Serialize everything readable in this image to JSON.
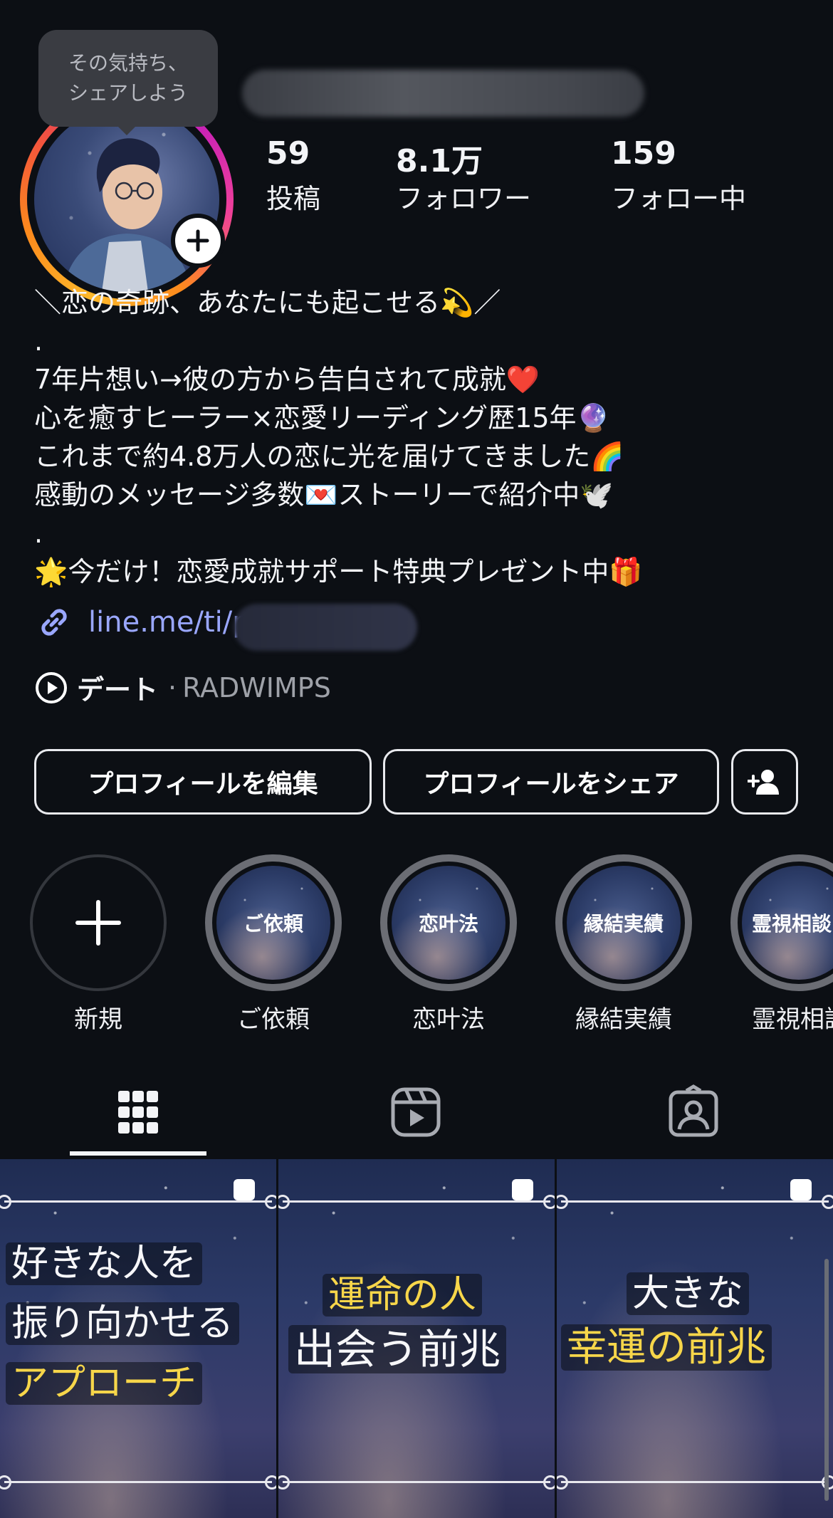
{
  "profile": {
    "tooltip_line1": "その気持ち、",
    "tooltip_line2": "シェアしよう",
    "stats": [
      {
        "value": "59",
        "label": "投稿"
      },
      {
        "value": "8.1万",
        "label": "フォロワー"
      },
      {
        "value": "159",
        "label": "フォロー中"
      }
    ],
    "bio": "＼恋の奇跡、あなたにも起こせる💫／\n.\n7年片想い→彼の方から告白されて成就❤️\n心を癒すヒーラー×恋愛リーディング歴15年🔮\nこれまで約4.8万人の恋に光を届けてきました🌈\n感動のメッセージ多数💌ストーリーで紹介中🕊️\n.\n🌟今だけ！恋愛成就サポート特典プレゼント中🎁",
    "link_text": "line.me/ti/p",
    "music_title": "デート",
    "music_separator": "·",
    "music_artist": "RADWIMPS"
  },
  "buttons": {
    "edit_label": "プロフィールを編集",
    "share_label": "プロフィールをシェア"
  },
  "highlights": [
    {
      "label": "新規",
      "cover_text": ""
    },
    {
      "label": "ご依頼",
      "cover_text": "ご依頼"
    },
    {
      "label": "恋叶法",
      "cover_text": "恋叶法"
    },
    {
      "label": "縁結実績",
      "cover_text": "縁結実績"
    },
    {
      "label": "霊視相談",
      "cover_text": "霊視相談"
    }
  ],
  "tabs": [
    {
      "icon": "grid-icon",
      "active": true
    },
    {
      "icon": "reels-icon",
      "active": false
    },
    {
      "icon": "tagged-icon",
      "active": false
    }
  ],
  "posts": [
    {
      "lines": [
        "好きな人を",
        "振り向かせる",
        "アプローチ"
      ]
    },
    {
      "lines": [
        "運命の人",
        "出会う前兆"
      ]
    },
    {
      "lines": [
        "大きな",
        "幸運の前兆"
      ]
    }
  ],
  "colors": {
    "background": "#0c0f14",
    "link": "#9aa7ff",
    "highlight_yellow": "#f7d64a"
  }
}
